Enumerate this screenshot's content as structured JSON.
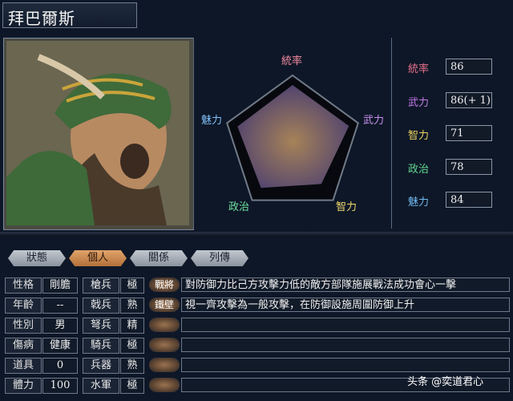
{
  "header": {
    "name": "拜巴爾斯"
  },
  "radar": {
    "labels": {
      "tongshuai": "統率",
      "wuli": "武力",
      "zhili": "智力",
      "zhengzhi": "政治",
      "meili": "魅力"
    },
    "values": [
      86,
      86,
      71,
      78,
      84
    ],
    "max": 100
  },
  "stats": [
    {
      "label": "統率",
      "value": "86",
      "color": "#e8708a"
    },
    {
      "label": "武力",
      "value": "86(+ 1)",
      "color": "#c07ae8"
    },
    {
      "label": "智力",
      "value": "71",
      "color": "#e8d060"
    },
    {
      "label": "政治",
      "value": "78",
      "color": "#60d890"
    },
    {
      "label": "魅力",
      "value": "84",
      "color": "#70b8f0"
    }
  ],
  "tabs": [
    {
      "label": "狀態",
      "active": false
    },
    {
      "label": "個人",
      "active": true
    },
    {
      "label": "關係",
      "active": false
    },
    {
      "label": "列傳",
      "active": false
    }
  ],
  "personal": [
    {
      "label": "性格",
      "value": "剛膽"
    },
    {
      "label": "年齡",
      "value": "--"
    },
    {
      "label": "性別",
      "value": "男"
    },
    {
      "label": "傷病",
      "value": "健康"
    },
    {
      "label": "道具",
      "value": "0"
    },
    {
      "label": "體力",
      "value": "100"
    }
  ],
  "weapons": [
    {
      "label": "槍兵",
      "value": "極"
    },
    {
      "label": "戟兵",
      "value": "熟"
    },
    {
      "label": "弩兵",
      "value": "精"
    },
    {
      "label": "騎兵",
      "value": "極"
    },
    {
      "label": "兵器",
      "value": "熟"
    },
    {
      "label": "水軍",
      "value": "極"
    }
  ],
  "skills": [
    {
      "name": "戰將",
      "desc": "對防御力比己方攻擊力低的敵方部隊施展戰法成功會心一擊"
    },
    {
      "name": "鐵壁",
      "desc": "視一齊攻擊為一般攻擊，在防御設施周圍防御上升"
    },
    {
      "name": "",
      "desc": ""
    },
    {
      "name": "",
      "desc": ""
    },
    {
      "name": "",
      "desc": ""
    },
    {
      "name": "",
      "desc": ""
    }
  ],
  "watermark": {
    "text": "头条 @奕道君心"
  }
}
